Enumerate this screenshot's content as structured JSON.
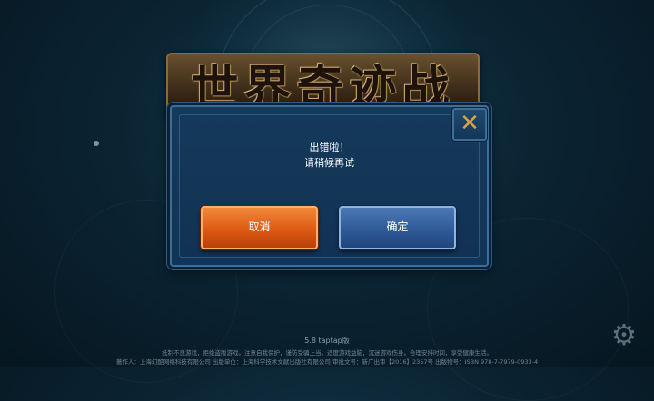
{
  "logo": {
    "title": "世界奇迹战记"
  },
  "dialog": {
    "message_line1": "出错啦！",
    "message_line2": "请稍候再试",
    "close_glyph": "✕",
    "cancel_label": "取消",
    "confirm_label": "确定"
  },
  "footer": {
    "version": "5.8 taptap版",
    "notice_line1": "抵制不良游戏，拒绝盗版游戏。注意自我保护，谨防受骗上当。适度游戏益脑，沉迷游戏伤身。合理安排时间，享受健康生活。",
    "notice_line2": "著作人：上海幻酷网络科技有限公司  出版单位：上海科学技术文献出版社有限公司  审批文号：新广出审【2016】2357号  出版物号：ISBN 978-7-7979-0933-4"
  },
  "icons": {
    "settings": "gear-icon",
    "close": "close-icon"
  },
  "colors": {
    "cancel": "#de5a14",
    "confirm": "#2f5a98",
    "close_accent": "#d8a04a",
    "dialog_bg": "#163a5c"
  }
}
